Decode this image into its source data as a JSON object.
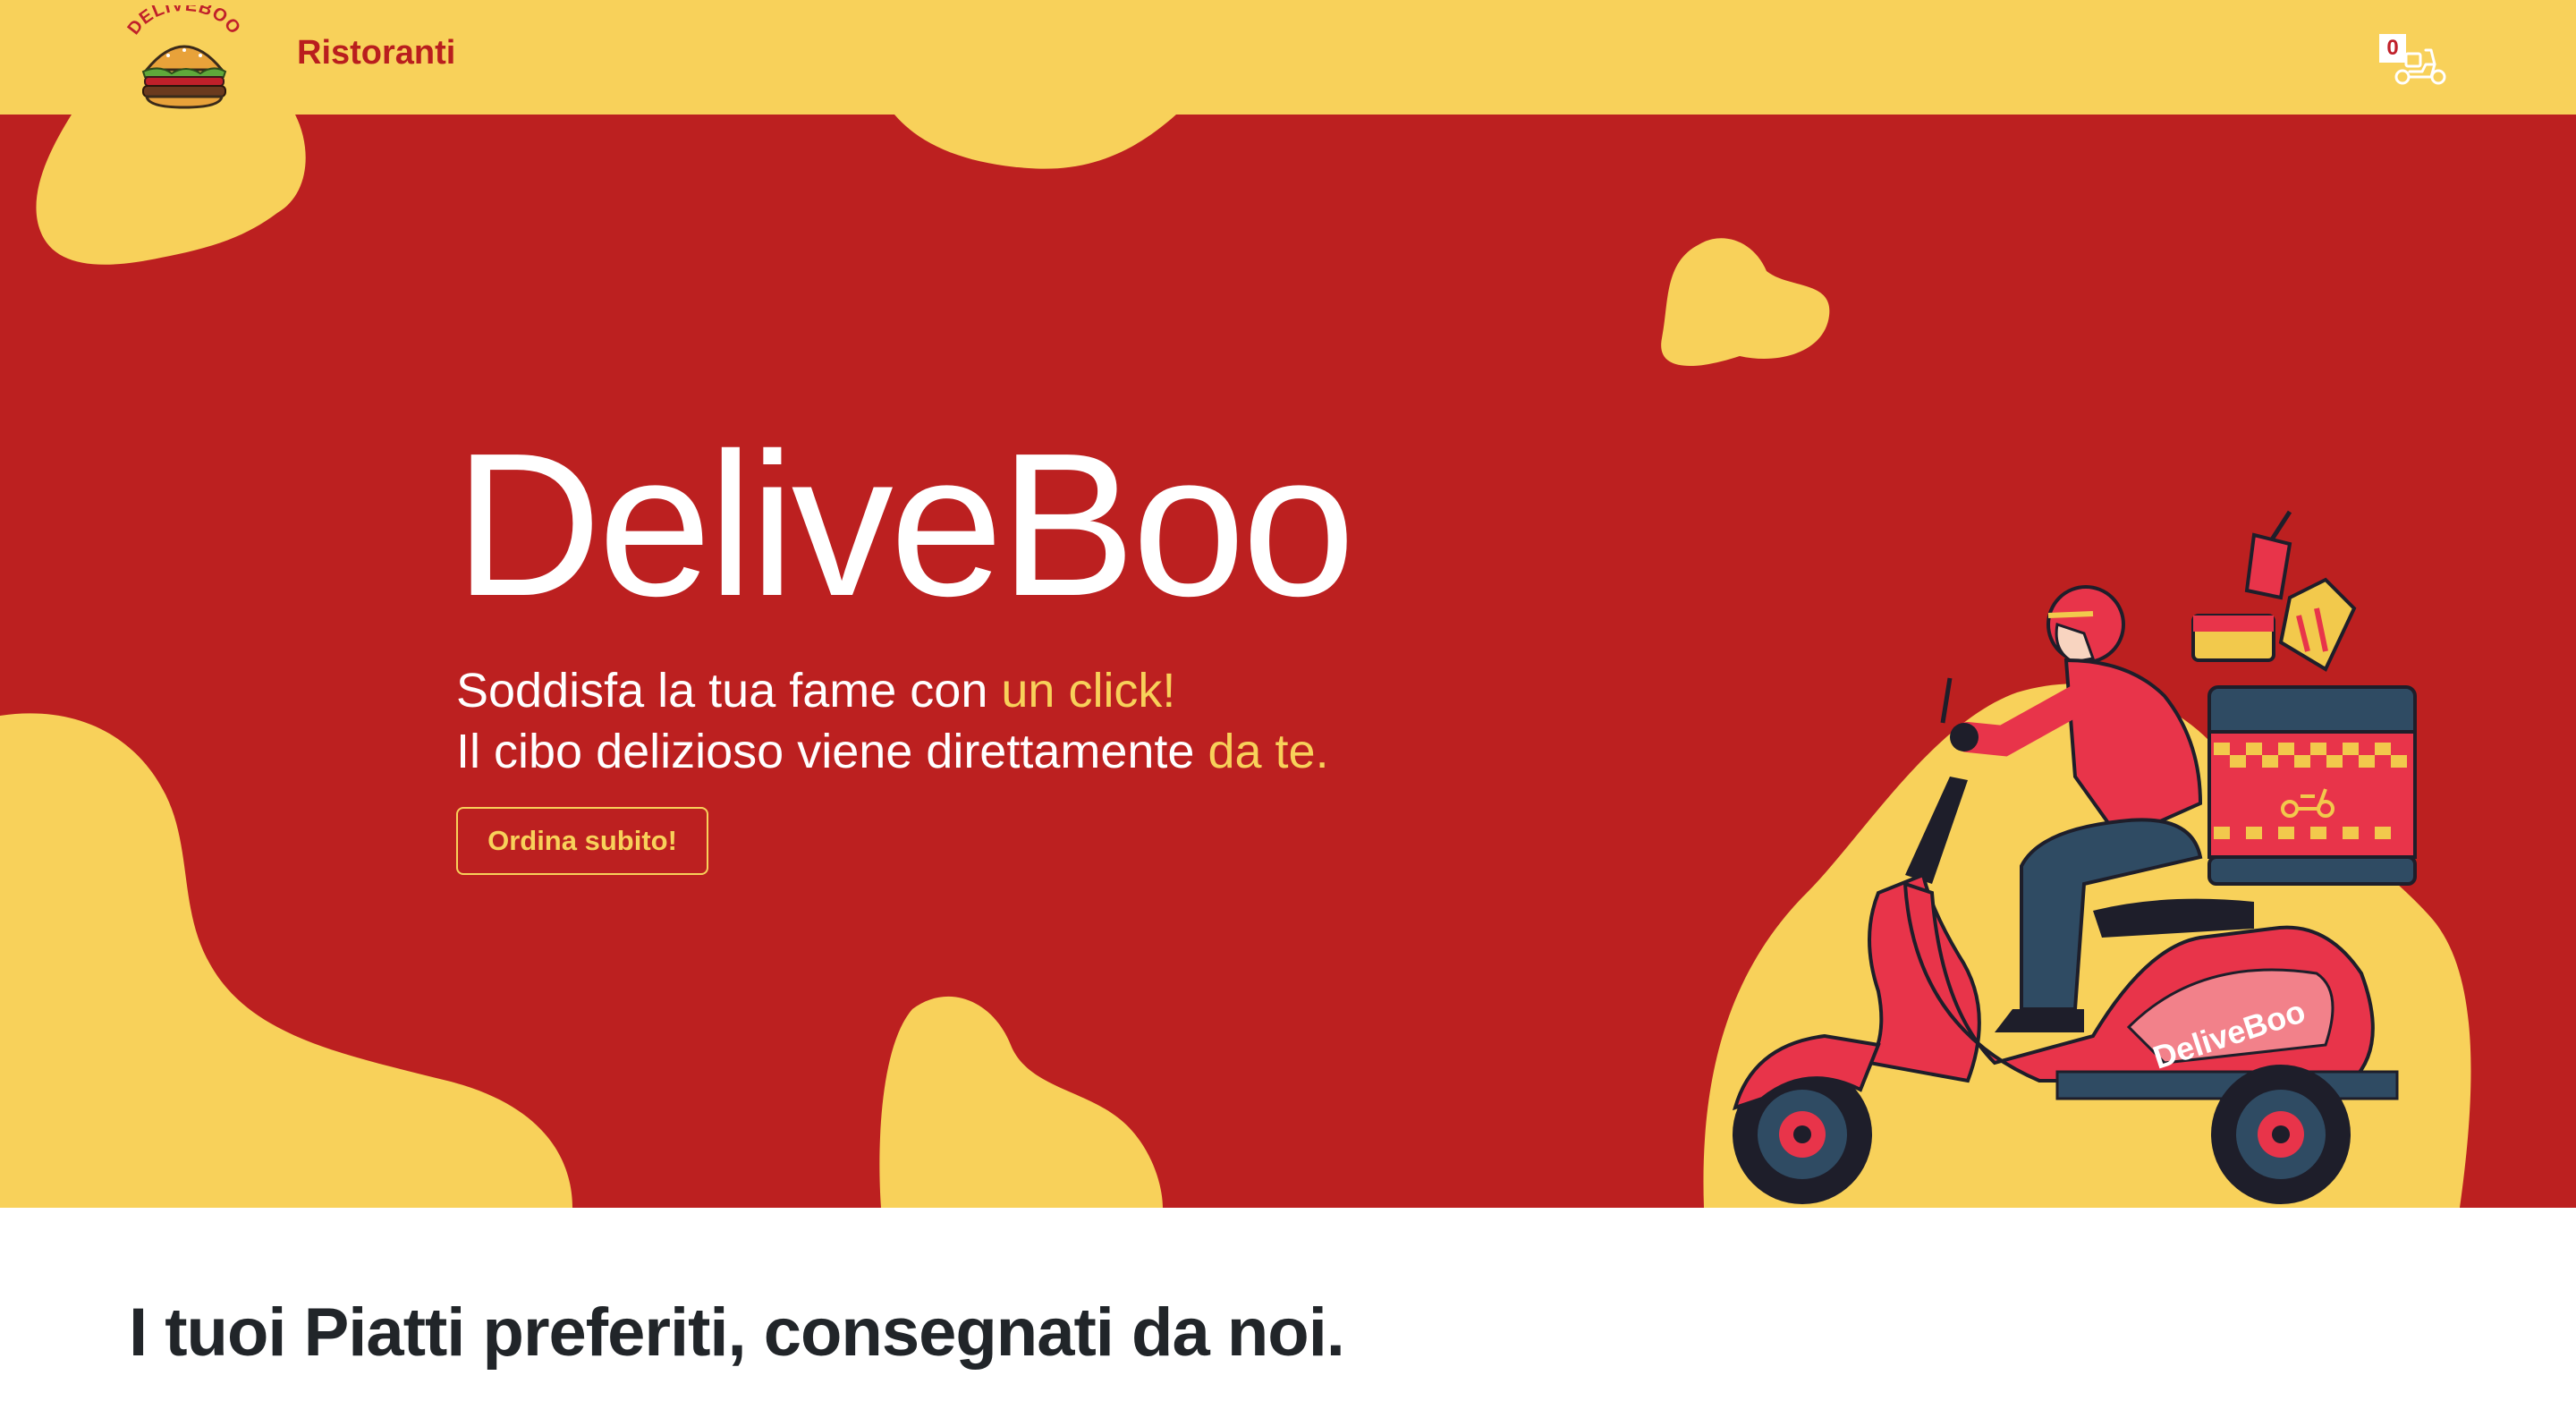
{
  "navbar": {
    "logo_text": "DELIVEBOO",
    "restaurants_link": "Ristoranti",
    "cart_count": "0",
    "cart_icon": "scooter-icon"
  },
  "hero": {
    "title": "DeliveBoo",
    "line1_prefix": "Soddisfa la tua fame con ",
    "line1_accent": "un click!",
    "line2_prefix": "Il cibo delizioso viene direttamente ",
    "line2_accent": "da te.",
    "cta_label": "Ordina subito!",
    "scooter_text": "DeliveBoo"
  },
  "section": {
    "heading": "I tuoi Piatti preferiti, consegnati da noi."
  },
  "colors": {
    "primary_red": "#BC2020",
    "accent_yellow": "#F8D15A",
    "text_dark": "#212529"
  }
}
